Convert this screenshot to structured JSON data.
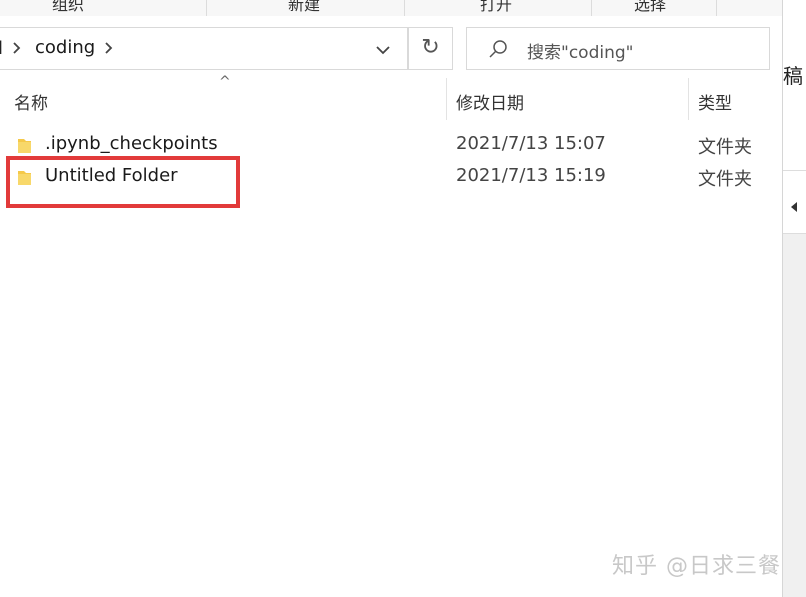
{
  "ribbon": {
    "groups": [
      "组织",
      "新建",
      "打开",
      "选择"
    ]
  },
  "address": {
    "prev_crumb": "l",
    "separator": ">",
    "current": "coding",
    "dropdown_icon": "chevron-down-icon",
    "refresh_glyph": "↻"
  },
  "search": {
    "placeholder": "搜索\"coding\""
  },
  "columns": {
    "name": "名称",
    "date": "修改日期",
    "type": "类型"
  },
  "rows": [
    {
      "name": ".ipynb_checkpoints",
      "date": "2021/7/13 15:07",
      "type": "文件夹"
    },
    {
      "name": "Untitled Folder",
      "date": "2021/7/13 15:19",
      "type": "文件夹"
    }
  ],
  "right_pane": {
    "partial_char": "稿"
  },
  "watermark": "知乎 @日求三餐",
  "colors": {
    "highlight": "#e23a3a",
    "folder": "#f5c94a"
  }
}
